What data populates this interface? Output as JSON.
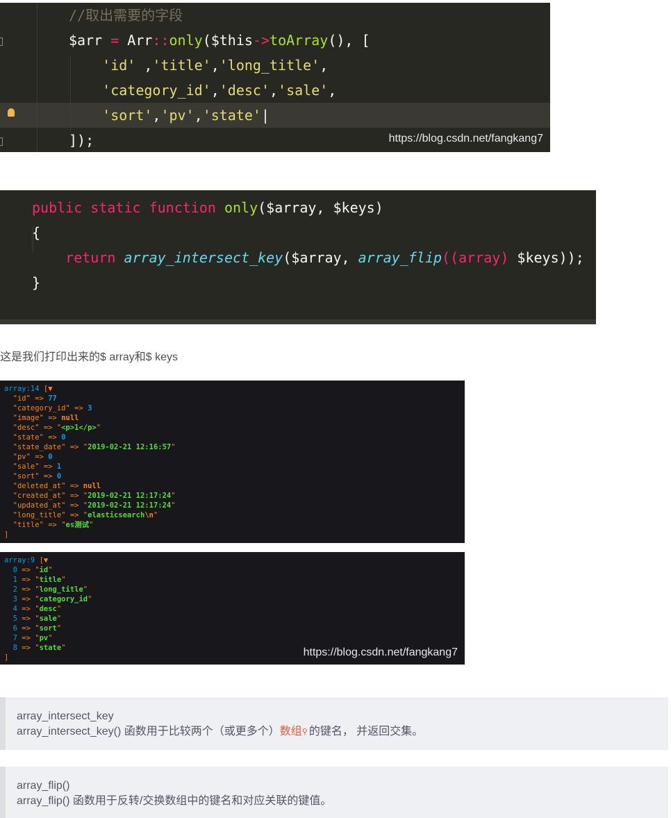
{
  "code_block_1": {
    "watermark": "https://blog.csdn.net/fangkang7",
    "lines": [
      [
        {
          "t": "//取出需要的字段",
          "c": "c"
        }
      ],
      [
        {
          "t": "$arr",
          "c": "w"
        },
        {
          "t": " = ",
          "c": "p"
        },
        {
          "t": "Arr",
          "c": "w"
        },
        {
          "t": "::",
          "c": "p"
        },
        {
          "t": "only",
          "c": "g"
        },
        {
          "t": "($this",
          "c": "w"
        },
        {
          "t": "->",
          "c": "p"
        },
        {
          "t": "toArray",
          "c": "g"
        },
        {
          "t": "(), [",
          "c": "w"
        }
      ],
      [
        {
          "t": "    'id'",
          "c": "y"
        },
        {
          "t": " ,",
          "c": "w"
        },
        {
          "t": "'title'",
          "c": "y"
        },
        {
          "t": ",",
          "c": "w"
        },
        {
          "t": "'long_title'",
          "c": "y"
        },
        {
          "t": ",",
          "c": "w"
        }
      ],
      [
        {
          "t": "    'category_id'",
          "c": "y"
        },
        {
          "t": ",",
          "c": "w"
        },
        {
          "t": "'desc'",
          "c": "y"
        },
        {
          "t": ",",
          "c": "w"
        },
        {
          "t": "'sale'",
          "c": "y"
        },
        {
          "t": ",",
          "c": "w"
        }
      ],
      [
        {
          "t": "    'sort'",
          "c": "y"
        },
        {
          "t": ",",
          "c": "w"
        },
        {
          "t": "'pv'",
          "c": "y"
        },
        {
          "t": ",",
          "c": "w"
        },
        {
          "t": "'state'",
          "c": "y"
        },
        {
          "t": "|",
          "c": "w"
        }
      ],
      [
        {
          "t": "]);",
          "c": "w"
        }
      ]
    ]
  },
  "code_block_2": {
    "lines": [
      [
        {
          "t": "public static function ",
          "c": "p"
        },
        {
          "t": "only",
          "c": "g"
        },
        {
          "t": "($array, $keys)",
          "c": "w"
        }
      ],
      [
        {
          "t": "{",
          "c": "w"
        }
      ],
      [
        {
          "t": "    return ",
          "c": "p"
        },
        {
          "t": "array_intersect_key",
          "c": "cy"
        },
        {
          "t": "($array, ",
          "c": "w"
        },
        {
          "t": "array_flip",
          "c": "cy"
        },
        {
          "t": "((array)",
          "c": "p"
        },
        {
          "t": " $keys));",
          "c": "w"
        }
      ],
      [
        {
          "t": "}",
          "c": "w"
        }
      ]
    ]
  },
  "caption": "这是我们打印出来的$ array和$ keys",
  "dump_1": {
    "lines": [
      [
        {
          "t": "array:14 ",
          "c": "b"
        },
        {
          "t": "[▼",
          "c": "o"
        }
      ],
      [
        {
          "t": "  \"id\" => ",
          "c": "o"
        },
        {
          "t": "77",
          "c": "n"
        }
      ],
      [
        {
          "t": "  \"category_id\" => ",
          "c": "o"
        },
        {
          "t": "3",
          "c": "n"
        }
      ],
      [
        {
          "t": "  \"image\" => ",
          "c": "o"
        },
        {
          "t": "null",
          "c": "r"
        }
      ],
      [
        {
          "t": "  \"desc\" => ",
          "c": "o"
        },
        {
          "t": "\"",
          "c": "o"
        },
        {
          "t": "<p>1</p>",
          "c": "g"
        },
        {
          "t": "\"",
          "c": "o"
        }
      ],
      [
        {
          "t": "  \"state\" => ",
          "c": "o"
        },
        {
          "t": "0",
          "c": "n"
        }
      ],
      [
        {
          "t": "  \"state_date\" => ",
          "c": "o"
        },
        {
          "t": "\"",
          "c": "o"
        },
        {
          "t": "2019-02-21 12:16:57",
          "c": "g"
        },
        {
          "t": "\"",
          "c": "o"
        }
      ],
      [
        {
          "t": "  \"pv\" => ",
          "c": "o"
        },
        {
          "t": "0",
          "c": "n"
        }
      ],
      [
        {
          "t": "  \"sale\" => ",
          "c": "o"
        },
        {
          "t": "1",
          "c": "n"
        }
      ],
      [
        {
          "t": "  \"sort\" => ",
          "c": "o"
        },
        {
          "t": "0",
          "c": "n"
        }
      ],
      [
        {
          "t": "  \"deleted_at\" => ",
          "c": "o"
        },
        {
          "t": "null",
          "c": "r"
        }
      ],
      [
        {
          "t": "  \"created_at\" => ",
          "c": "o"
        },
        {
          "t": "\"",
          "c": "o"
        },
        {
          "t": "2019-02-21 12:17:24",
          "c": "g"
        },
        {
          "t": "\"",
          "c": "o"
        }
      ],
      [
        {
          "t": "  \"updated_at\" => ",
          "c": "o"
        },
        {
          "t": "\"",
          "c": "o"
        },
        {
          "t": "2019-02-21 12:17:24",
          "c": "g"
        },
        {
          "t": "\"",
          "c": "o"
        }
      ],
      [
        {
          "t": "  \"long_title\" => ",
          "c": "o"
        },
        {
          "t": "\"",
          "c": "o"
        },
        {
          "t": "elasticsearch",
          "c": "g"
        },
        {
          "t": "\\n",
          "c": "r"
        },
        {
          "t": "\"",
          "c": "o"
        }
      ],
      [
        {
          "t": "  \"title\" => ",
          "c": "o"
        },
        {
          "t": "\"",
          "c": "o"
        },
        {
          "t": "es测试",
          "c": "g"
        },
        {
          "t": "\"",
          "c": "o"
        }
      ],
      [
        {
          "t": "]",
          "c": "o"
        }
      ]
    ]
  },
  "dump_2": {
    "watermark": "https://blog.csdn.net/fangkang7",
    "lines": [
      [
        {
          "t": "array:9 ",
          "c": "b"
        },
        {
          "t": "[▼",
          "c": "o"
        }
      ],
      [
        {
          "t": "  0",
          "c": "b"
        },
        {
          "t": " => \"",
          "c": "o"
        },
        {
          "t": "id",
          "c": "g"
        },
        {
          "t": "\"",
          "c": "o"
        }
      ],
      [
        {
          "t": "  1",
          "c": "b"
        },
        {
          "t": " => \"",
          "c": "o"
        },
        {
          "t": "title",
          "c": "g"
        },
        {
          "t": "\"",
          "c": "o"
        }
      ],
      [
        {
          "t": "  2",
          "c": "b"
        },
        {
          "t": " => \"",
          "c": "o"
        },
        {
          "t": "long_title",
          "c": "g"
        },
        {
          "t": "\"",
          "c": "o"
        }
      ],
      [
        {
          "t": "  3",
          "c": "b"
        },
        {
          "t": " => \"",
          "c": "o"
        },
        {
          "t": "category_id",
          "c": "g"
        },
        {
          "t": "\"",
          "c": "o"
        }
      ],
      [
        {
          "t": "  4",
          "c": "b"
        },
        {
          "t": " => \"",
          "c": "o"
        },
        {
          "t": "desc",
          "c": "g"
        },
        {
          "t": "\"",
          "c": "o"
        }
      ],
      [
        {
          "t": "  5",
          "c": "b"
        },
        {
          "t": " => \"",
          "c": "o"
        },
        {
          "t": "sale",
          "c": "g"
        },
        {
          "t": "\"",
          "c": "o"
        }
      ],
      [
        {
          "t": "  6",
          "c": "b"
        },
        {
          "t": " => \"",
          "c": "o"
        },
        {
          "t": "sort",
          "c": "g"
        },
        {
          "t": "\"",
          "c": "o"
        }
      ],
      [
        {
          "t": "  7",
          "c": "b"
        },
        {
          "t": " => \"",
          "c": "o"
        },
        {
          "t": "pv",
          "c": "g"
        },
        {
          "t": "\"",
          "c": "o"
        }
      ],
      [
        {
          "t": "  8",
          "c": "b"
        },
        {
          "t": " => \"",
          "c": "o"
        },
        {
          "t": "state",
          "c": "g"
        },
        {
          "t": "\"",
          "c": "o"
        }
      ],
      [
        {
          "t": "]",
          "c": "o"
        }
      ]
    ]
  },
  "quote_1": {
    "title": "array_intersect_key",
    "desc_before": "array_intersect_key() 函数用于比较两个（或更多个）",
    "link": "数组",
    "desc_after": "的键名， 并返回交集。"
  },
  "quote_2": {
    "title": "array_flip()",
    "desc": "array_flip() 函数用于反转/交换数组中的键名和对应关联的键值。"
  }
}
